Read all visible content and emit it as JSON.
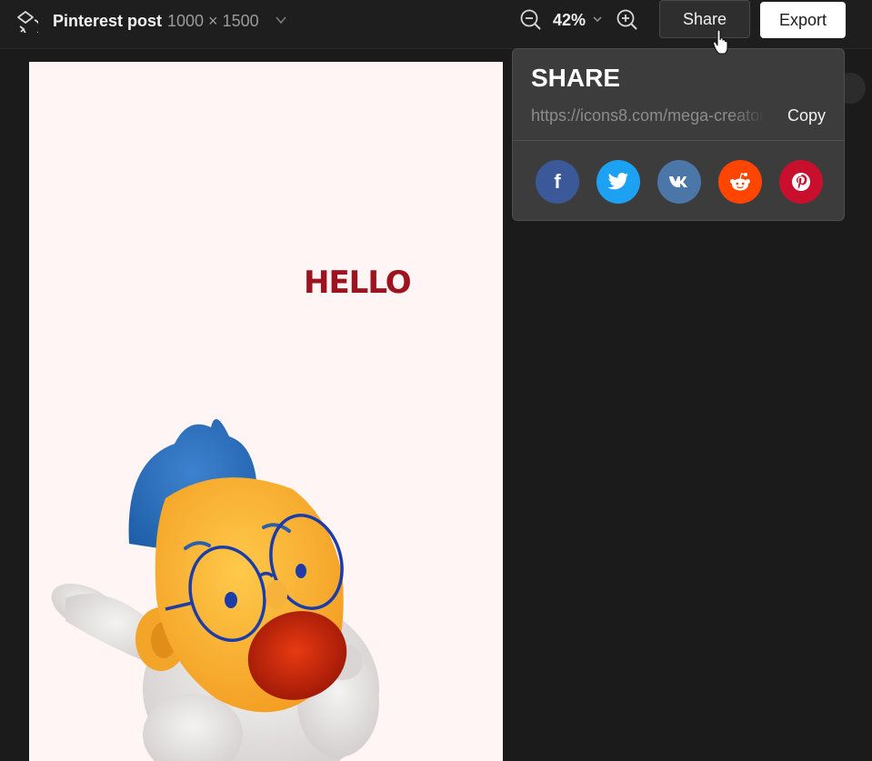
{
  "header": {
    "doc_title": "Pinterest post",
    "doc_size": "1000 × 1500",
    "zoom": "42%",
    "share_label": "Share",
    "export_label": "Export"
  },
  "canvas": {
    "headline": "HELLO",
    "background_color": "#fff5f4",
    "headline_color": "#9e1320"
  },
  "share_panel": {
    "heading": "SHARE",
    "url": "https://icons8.com/mega-creator",
    "copy_label": "Copy",
    "networks": [
      {
        "name": "facebook",
        "icon": "facebook-icon",
        "color": "#3b5998"
      },
      {
        "name": "twitter",
        "icon": "twitter-icon",
        "color": "#1da1f2"
      },
      {
        "name": "vk",
        "icon": "vk-icon",
        "color": "#4a76a8"
      },
      {
        "name": "reddit",
        "icon": "reddit-icon",
        "color": "#ff4500"
      },
      {
        "name": "pinterest",
        "icon": "pinterest-icon",
        "color": "#c8102e"
      }
    ]
  },
  "colors": {
    "app_background": "#1b1b1b",
    "panel_background": "#3c3c3c",
    "export_button": "#ffffff"
  }
}
